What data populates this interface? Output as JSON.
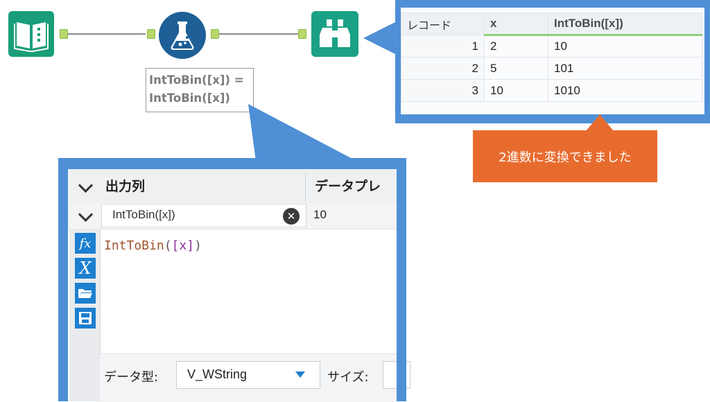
{
  "workflow": {
    "tools": [
      {
        "name": "input-data",
        "icon": "book-icon"
      },
      {
        "name": "formula",
        "icon": "flask-icon"
      },
      {
        "name": "browse",
        "icon": "binoculars-icon"
      }
    ],
    "formula_annotation": [
      "IntToBin([x]) =",
      "IntToBin([x])"
    ]
  },
  "results": {
    "columns": [
      "レコード",
      "x",
      "IntToBin([x])"
    ],
    "rows": [
      {
        "record": "1",
        "x": "2",
        "bin": "10"
      },
      {
        "record": "2",
        "x": "5",
        "bin": "101"
      },
      {
        "record": "3",
        "x": "10",
        "bin": "1010"
      }
    ]
  },
  "note": {
    "text": "2進数に変換できました",
    "color": "#e86b2e"
  },
  "formula_config": {
    "header_output_col": "出力列",
    "header_preview": "データプレ",
    "field_name": "IntToBin([x])",
    "preview_value": "10",
    "expression": {
      "fn": "IntToBin",
      "open": "(",
      "field": "[x]",
      "close": ")"
    },
    "side_buttons": [
      "fx-icon",
      "variable-x-icon",
      "open-folder-icon",
      "save-icon"
    ],
    "data_type_label": "データ型:",
    "data_type_value": "V_WString",
    "size_label": "サイズ:"
  },
  "colors": {
    "callout_blue": "#4e8fd6",
    "accent_blue": "#1c7fcf"
  }
}
